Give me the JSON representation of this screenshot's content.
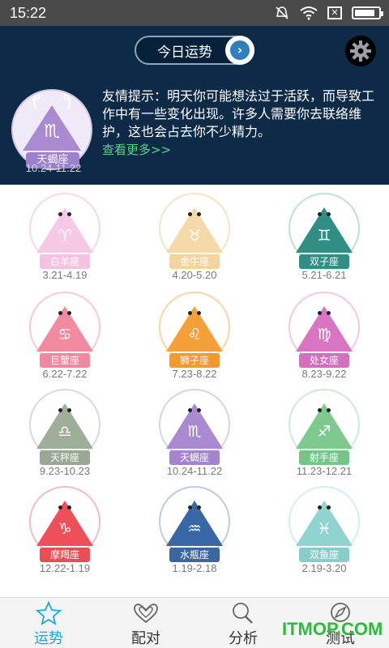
{
  "status_bar": {
    "time": "15:22",
    "icons": [
      "signal-muted-icon",
      "wifi-icon",
      "sim-icon",
      "battery-icon"
    ],
    "battery_level": 0.85
  },
  "header": {
    "fortune_button": "今日运势",
    "featured": {
      "sign": "天蝎座",
      "glyph": "♏",
      "dates": "10.24-11.22",
      "color": "#a98ad1"
    },
    "tip": "友情提示：明天你可能想法过于活跃，而导致工作中有一些变化出现。许多人需要你去联络维护，这也会占去你不少精力。",
    "more": "查看更多>>"
  },
  "signs": [
    {
      "name": "白羊座",
      "dates": "3.21-4.19",
      "glyph": "♈",
      "color": "#f6c9e4",
      "tag_color": "#f4c3df",
      "ring": "#f7d7ea"
    },
    {
      "name": "金牛座",
      "dates": "4.20-5.20",
      "glyph": "♉",
      "color": "#f5d9a8",
      "tag_color": "#f4d5a0",
      "ring": "#f5e5c5"
    },
    {
      "name": "双子座",
      "dates": "5.21-6.21",
      "glyph": "♊",
      "color": "#2e8f82",
      "tag_color": "#2e8f82",
      "ring": "#bfe0d9"
    },
    {
      "name": "巨蟹座",
      "dates": "6.22-7.22",
      "glyph": "♋",
      "color": "#f28aa0",
      "tag_color": "#f2879e",
      "ring": "#f8c9d2"
    },
    {
      "name": "狮子座",
      "dates": "7.23-8.22",
      "glyph": "♌",
      "color": "#f6a03a",
      "tag_color": "#f39a2e",
      "ring": "#f8d4a8"
    },
    {
      "name": "处女座",
      "dates": "8.23-9.22",
      "glyph": "♍",
      "color": "#d874c2",
      "tag_color": "#d46fc0",
      "ring": "#f0c8e6"
    },
    {
      "name": "天秤座",
      "dates": "9.23-10.23",
      "glyph": "♎",
      "color": "#9fae98",
      "tag_color": "#99a892",
      "ring": "#d6ddd3"
    },
    {
      "name": "天蝎座",
      "dates": "10.24-11.22",
      "glyph": "♏",
      "color": "#a98ad1",
      "tag_color": "#a384cd",
      "ring": "#ddd0ee"
    },
    {
      "name": "射手座",
      "dates": "11.23-12.21",
      "glyph": "♐",
      "color": "#7ec98e",
      "tag_color": "#76c488",
      "ring": "#cdebd4"
    },
    {
      "name": "摩羯座",
      "dates": "12.22-1.19",
      "glyph": "♑",
      "color": "#ef4f59",
      "tag_color": "#ec4c56",
      "ring": "#f6bcc0"
    },
    {
      "name": "水瓶座",
      "dates": "1.19-2.18",
      "glyph": "♒",
      "color": "#3a68a6",
      "tag_color": "#3a66a2",
      "ring": "#bccbe0"
    },
    {
      "name": "双鱼座",
      "dates": "2.19-3.20",
      "glyph": "♓",
      "color": "#8fd4cf",
      "tag_color": "#86cfc9",
      "ring": "#d3efec"
    }
  ],
  "nav": [
    {
      "label": "运势",
      "icon": "star-icon",
      "active": true
    },
    {
      "label": "配对",
      "icon": "hearts-icon",
      "active": false
    },
    {
      "label": "分析",
      "icon": "magnifier-icon",
      "active": false
    },
    {
      "label": "测试",
      "icon": "compass-icon",
      "active": false
    }
  ],
  "watermark": "ITMOP.COM"
}
